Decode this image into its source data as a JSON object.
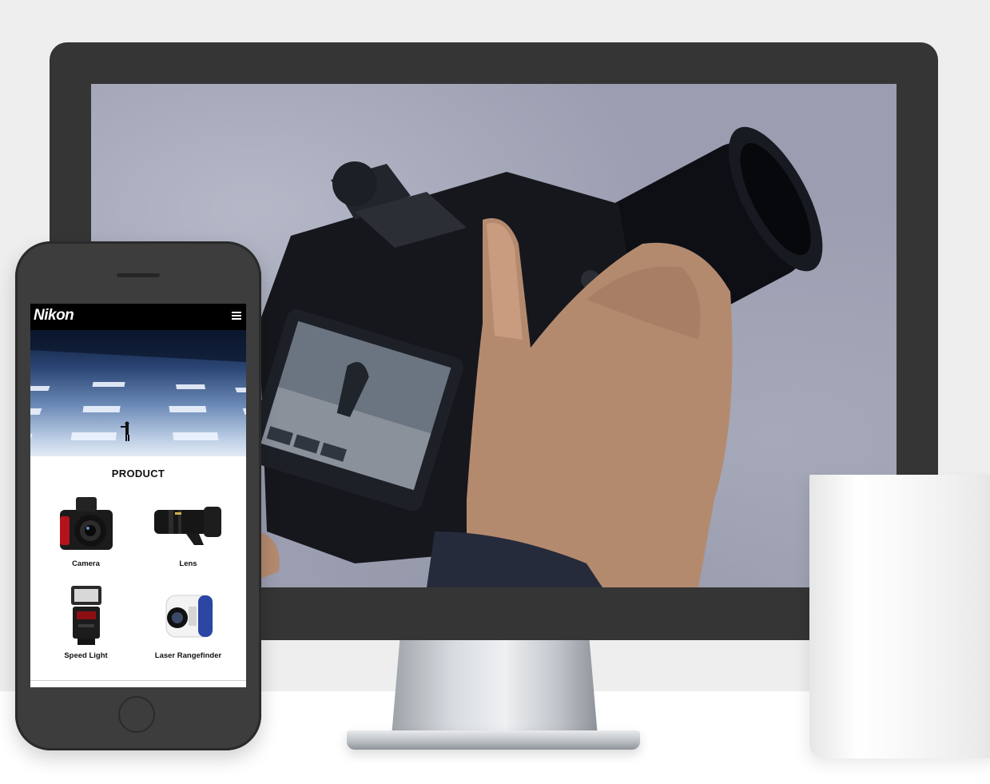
{
  "mobile": {
    "brand": "Nikon",
    "menu_icon": "hamburger-menu-icon",
    "section_title": "PRODUCT",
    "products": [
      {
        "label": "Camera",
        "icon": "camera-icon"
      },
      {
        "label": "Lens",
        "icon": "lens-icon"
      },
      {
        "label": "Speed Light",
        "icon": "flash-icon"
      },
      {
        "label": "Laser Rangefinder",
        "icon": "rangefinder-icon"
      }
    ]
  },
  "colors": {
    "device_frame": "#353535",
    "header_bg": "#000000",
    "wall": "#eeeeef"
  }
}
